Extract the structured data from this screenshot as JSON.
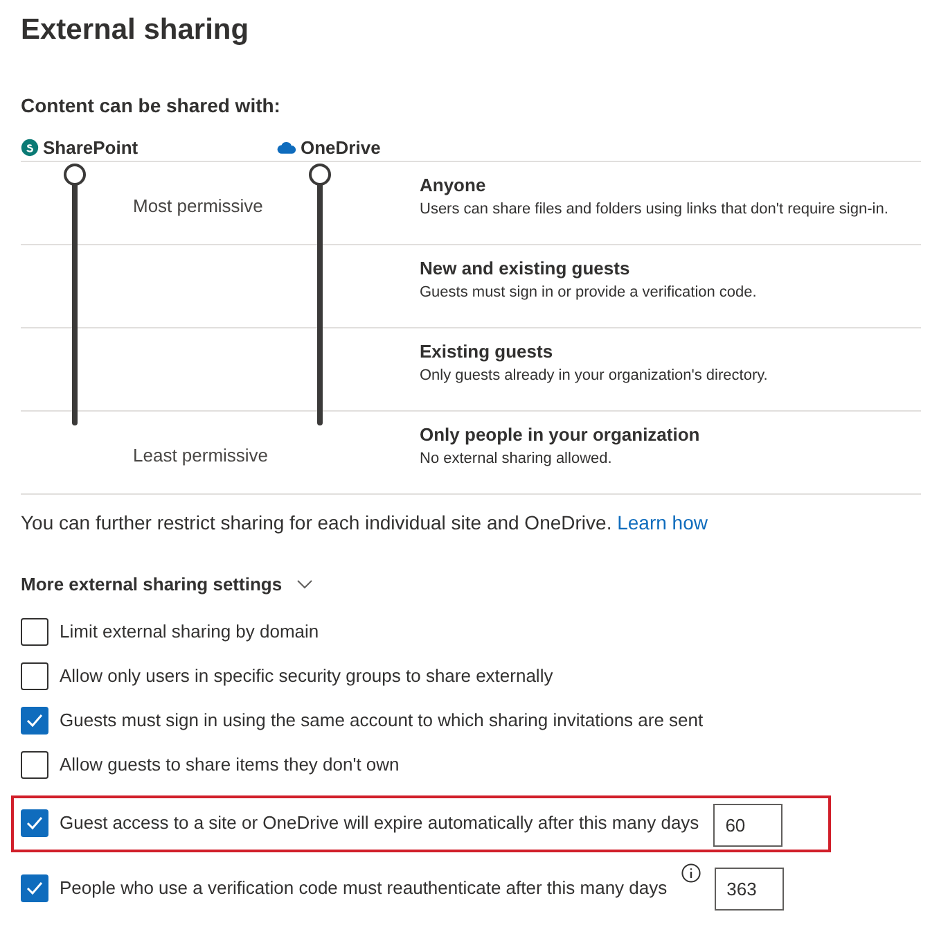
{
  "title": "External sharing",
  "section_label": "Content can be shared with:",
  "sliders": [
    {
      "name": "SharePoint",
      "kind": "sharepoint",
      "level": 1
    },
    {
      "name": "OneDrive",
      "kind": "onedrive",
      "level": 1
    }
  ],
  "slider_labels": {
    "top": "Most permissive",
    "bottom": "Least permissive"
  },
  "levels": [
    {
      "title": "Anyone",
      "description": "Users can share files and folders using links that don't require sign-in."
    },
    {
      "title": "New and existing guests",
      "description": "Guests must sign in or provide a verification code."
    },
    {
      "title": "Existing guests",
      "description": "Only guests already in your organization's directory."
    },
    {
      "title": "Only people in your organization",
      "description": "No external sharing allowed."
    }
  ],
  "note": {
    "text": "You can further restrict sharing for each individual site and OneDrive.",
    "link": "Learn how"
  },
  "more_settings": {
    "title": "More external sharing settings",
    "expanded": true
  },
  "options": [
    {
      "label": "Limit external sharing by domain",
      "checked": false
    },
    {
      "label": "Allow only users in specific security groups to share externally",
      "checked": false
    },
    {
      "label": "Guests must sign in using the same account to which sharing invitations are sent",
      "checked": true
    },
    {
      "label": "Allow guests to share items they don't own",
      "checked": false
    },
    {
      "label": "Guest access to a site or OneDrive will expire automatically after this many days",
      "checked": true,
      "highlighted": true,
      "days": "60"
    },
    {
      "label": "People who use a verification code must reauthenticate after this many days",
      "checked": true,
      "info": true,
      "days": "363"
    }
  ]
}
